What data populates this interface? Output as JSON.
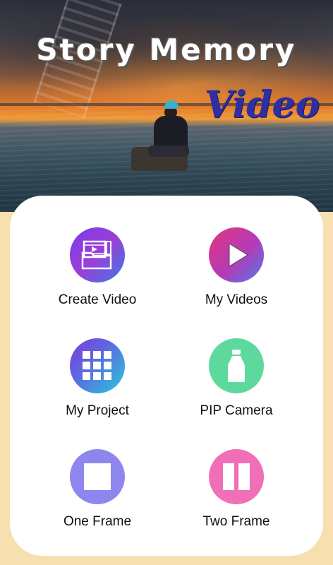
{
  "header": {
    "title": "Story Memory",
    "subtitle": "Video"
  },
  "menu": {
    "items": [
      {
        "label": "Create Video",
        "icon": "film-folder-icon",
        "color": "#8a3fe0"
      },
      {
        "label": "My Videos",
        "icon": "play-icon",
        "color": "#e2367a"
      },
      {
        "label": "My Project",
        "icon": "grid-icon",
        "color": "#27c9dc"
      },
      {
        "label": "PIP Camera",
        "icon": "bottle-icon",
        "color": "#5ed99d"
      },
      {
        "label": "One Frame",
        "icon": "square-frame-icon",
        "color": "#8e86ee"
      },
      {
        "label": "Two Frame",
        "icon": "two-frame-icon",
        "color": "#f06fb6"
      }
    ]
  },
  "colors": {
    "background": "#f7dfb0",
    "card": "#ffffff",
    "subtitle": "#2e2fa0"
  }
}
